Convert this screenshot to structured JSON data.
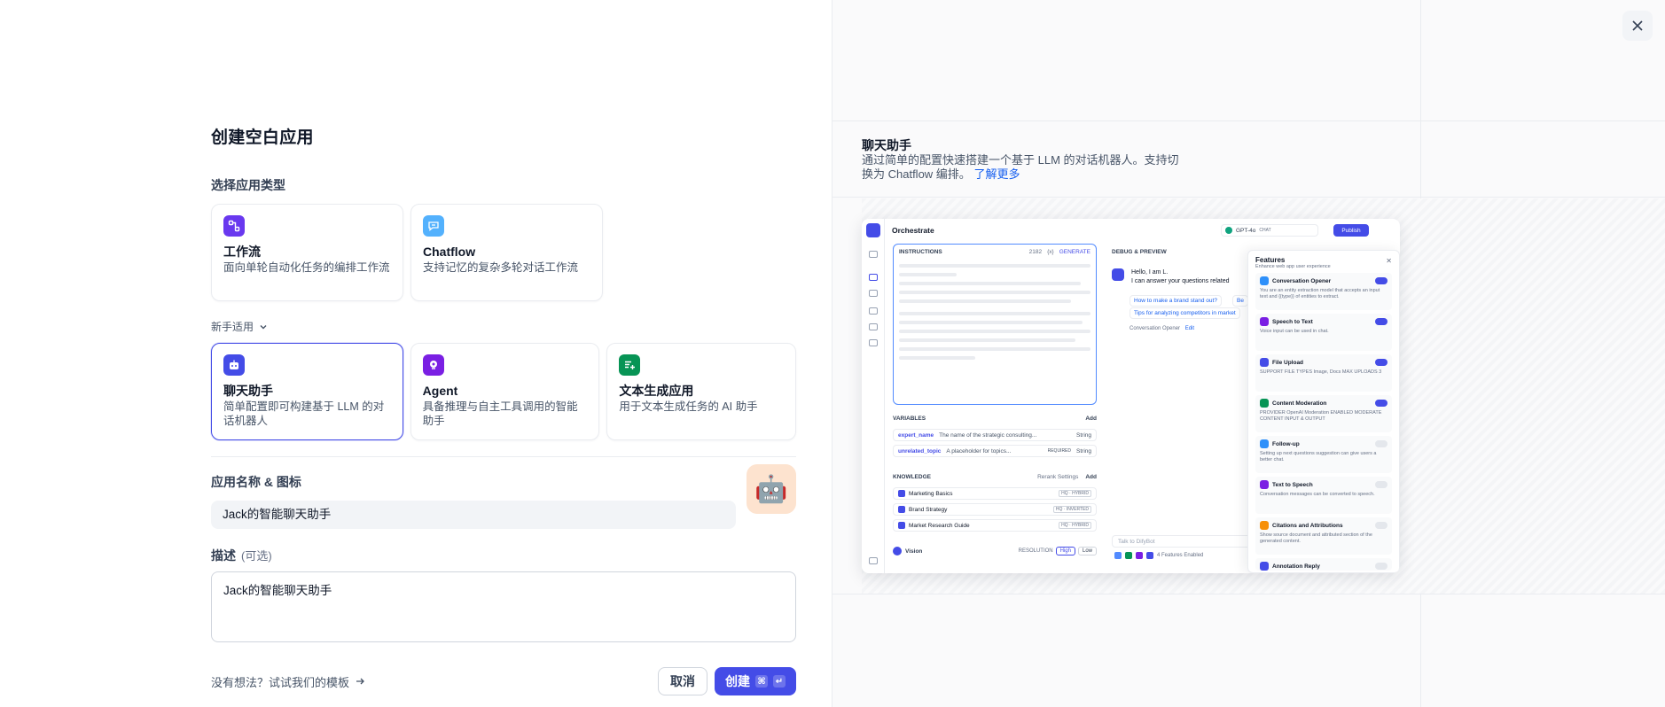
{
  "dialog": {
    "close_icon": "close-icon"
  },
  "form": {
    "title": "创建空白应用",
    "type_section_label": "选择应用类型",
    "advanced_types": [
      {
        "name": "工作流",
        "desc": "面向单轮自动化任务的编排工作流",
        "color": "#6938ef"
      },
      {
        "name": "Chatflow",
        "desc": "支持记忆的复杂多轮对话工作流",
        "color": "#53b1fd"
      }
    ],
    "novice_label": "新手适用",
    "basic_types": [
      {
        "name": "聊天助手",
        "desc": "简单配置即可构建基于 LLM 的对话机器人",
        "color": "#444ce7",
        "selected": true
      },
      {
        "name": "Agent",
        "desc": "具备推理与自主工具调用的智能助手",
        "color": "#7a1fe3"
      },
      {
        "name": "文本生成应用",
        "desc": "用于文本生成任务的 AI 助手",
        "color": "#079455"
      }
    ],
    "name_label": "应用名称 & 图标",
    "name_value": "Jack的智能聊天助手",
    "icon_emoji": "🤖",
    "desc_label": "描述",
    "desc_optional": "(可选)",
    "desc_value": "Jack的智能聊天助手",
    "template_link": "没有想法？试试我们的模板",
    "cancel_label": "取消",
    "create_label": "创建",
    "create_kbd": [
      "⌘",
      "↵"
    ]
  },
  "preview": {
    "title": "聊天助手",
    "desc": "通过简单的配置快速搭建一个基于 LLM 的对话机器人。支持切换为 Chatflow 编排。",
    "more_link": "了解更多",
    "shot": {
      "header": "Orchestrate",
      "model": "GPT-4o",
      "model_tag": "CHAT",
      "publish": "Publish",
      "instructions_label": "INSTRUCTIONS",
      "instructions_count": "2182",
      "instructions_var": "{x}",
      "generate": "GENERATE",
      "variables_label": "VARIABLES",
      "add_label": "Add",
      "variables": [
        {
          "key": "expert_name",
          "desc": "The name of the strategic consulting...",
          "type": "String"
        },
        {
          "key": "unrelated_topic",
          "desc": "A placeholder for topics...",
          "type": "String",
          "required": "REQUIRED"
        }
      ],
      "knowledge_label": "KNOWLEDGE",
      "rerank": "Rerank Settings",
      "knowledge": [
        {
          "name": "Marketing Basics",
          "tag": "HQ · HYBRID"
        },
        {
          "name": "Brand Strategy",
          "tag": "HQ · INVERTED"
        },
        {
          "name": "Market Research Guide",
          "tag": "HQ · HYBRID"
        }
      ],
      "vision": "Vision",
      "resolution": "RESOLUTION",
      "res_high": "High",
      "res_low": "Low",
      "debug_label": "DEBUG & PREVIEW",
      "chat_hello": "Hello, I am L.",
      "chat_line2": "I can answer your questions related",
      "suggestions": [
        "How to make a brand stand out?",
        "Tips for analyzing competitors in market"
      ],
      "suggestion_tail": "Be",
      "opener": "Conversation Opener",
      "opener_edit": "Edit",
      "talk_placeholder": "Talk to DifyBot",
      "features_enabled": "4 Features Enabled",
      "features": {
        "title": "Features",
        "subtitle": "Enhance web app user experience",
        "items": [
          {
            "name": "Conversation Opener",
            "desc": "You are an entity extraction model that accepts an input text and {{type}} of entities to extract.",
            "on": true,
            "color": "#2e90fa"
          },
          {
            "name": "Speech to Text",
            "desc": "Voice input can be used in chat.",
            "on": true,
            "color": "#7a1fe3"
          },
          {
            "name": "File Upload",
            "desc": "SUPPORT FILE TYPES  Image, Docs   MAX UPLOADS 3",
            "on": true,
            "color": "#444ce7"
          },
          {
            "name": "Content Moderation",
            "desc": "PROVIDER OpenAI Moderation   ENABLED MODERATE CONTENT INPUT & OUTPUT",
            "on": true,
            "color": "#079455"
          },
          {
            "name": "Follow-up",
            "desc": "Setting up next questions suggestion can give users a better chat.",
            "on": false,
            "color": "#2e90fa"
          },
          {
            "name": "Text to Speech",
            "desc": "Conversation messages can be converted to speech.",
            "on": false,
            "color": "#7a1fe3"
          },
          {
            "name": "Citations and Attributions",
            "desc": "Show source document and attributed section of the generated content.",
            "on": false,
            "color": "#f79009"
          },
          {
            "name": "Annotation Reply",
            "desc": "",
            "on": false,
            "color": "#444ce7"
          }
        ]
      }
    }
  }
}
